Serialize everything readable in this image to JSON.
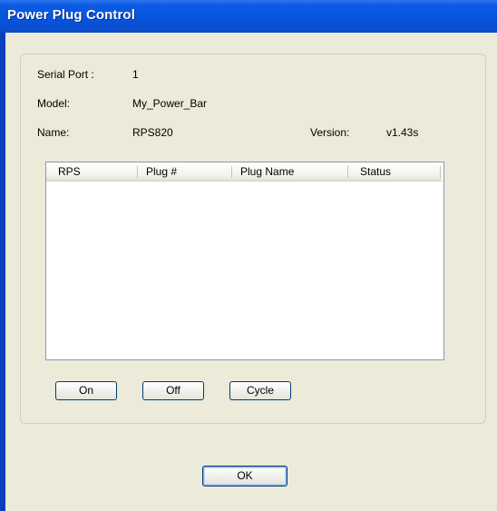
{
  "window": {
    "title": "Power Plug Control"
  },
  "info": {
    "serial_port_label": "Serial Port :",
    "serial_port_value": "1",
    "model_label": "Model:",
    "model_value": "My_Power_Bar",
    "name_label": "Name:",
    "name_value": "RPS820",
    "version_label": "Version:",
    "version_value": "v1.43s"
  },
  "plug_list": {
    "columns": [
      "RPS",
      "Plug #",
      "Plug Name",
      "Status"
    ],
    "rows": []
  },
  "actions": {
    "on_label": "On",
    "off_label": "Off",
    "cycle_label": "Cycle"
  },
  "dialog": {
    "ok_label": "OK"
  },
  "colors": {
    "titlebar": "#0554dd",
    "dialog_background": "#ecead8",
    "button_border": "#003c74"
  }
}
